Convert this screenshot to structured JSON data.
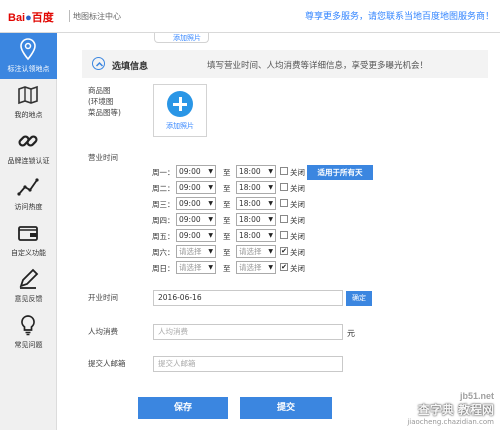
{
  "header": {
    "logo_text_1": "Bai",
    "logo_text_2": "百度",
    "title": "地图标注中心",
    "promo": "尊享更多服务，请您联系当地百度地图服务商！"
  },
  "sidebar": {
    "items": [
      {
        "label": "标注认领地点",
        "icon": "location-pin-icon",
        "active": true
      },
      {
        "label": "我的地点",
        "icon": "map-icon",
        "active": false
      },
      {
        "label": "品牌连锁认证",
        "icon": "link-icon",
        "active": false
      },
      {
        "label": "访问热度",
        "icon": "line-chart-icon",
        "active": false
      },
      {
        "label": "自定义功能",
        "icon": "wallet-icon",
        "active": false
      },
      {
        "label": "意见反馈",
        "icon": "pencil-icon",
        "active": false
      },
      {
        "label": "常见问题",
        "icon": "lightbulb-icon",
        "active": false
      }
    ]
  },
  "top_stub": {
    "label": "添加照片"
  },
  "section": {
    "title": "选填信息",
    "description": "填写营业时间、人均消费等详细信息，享受更多曝光机会！"
  },
  "photo": {
    "label_line1": "商品图",
    "label_line2": "(环境图",
    "label_line3": "菜品图等)",
    "add_label": "添加照片"
  },
  "hours": {
    "label": "营业时间",
    "to": "至",
    "closed_label": "关闭",
    "apply_all": "适用于所有天",
    "rows": [
      {
        "day": "周一：",
        "start": "09:00",
        "end": "18:00",
        "closed": false,
        "placeholder": false
      },
      {
        "day": "周二：",
        "start": "09:00",
        "end": "18:00",
        "closed": false,
        "placeholder": false
      },
      {
        "day": "周三：",
        "start": "09:00",
        "end": "18:00",
        "closed": false,
        "placeholder": false
      },
      {
        "day": "周四：",
        "start": "09:00",
        "end": "18:00",
        "closed": false,
        "placeholder": false
      },
      {
        "day": "周五：",
        "start": "09:00",
        "end": "18:00",
        "closed": false,
        "placeholder": false
      },
      {
        "day": "周六：",
        "start": "请选择",
        "end": "请选择",
        "closed": true,
        "placeholder": true
      },
      {
        "day": "周日：",
        "start": "请选择",
        "end": "请选择",
        "closed": true,
        "placeholder": true
      }
    ]
  },
  "opening_date": {
    "label": "开业时间",
    "value": "2016-06-16",
    "confirm": "确定"
  },
  "avg_spend": {
    "label": "人均消费",
    "placeholder": "人均消费",
    "unit": "元"
  },
  "email": {
    "label": "提交人邮箱",
    "placeholder": "提交人邮箱"
  },
  "actions": {
    "save": "保存",
    "submit": "提交"
  },
  "watermark": {
    "line1": "jb51.net",
    "line2": "查字典 教程网",
    "line3": "jiaocheng.chazidian.com"
  }
}
